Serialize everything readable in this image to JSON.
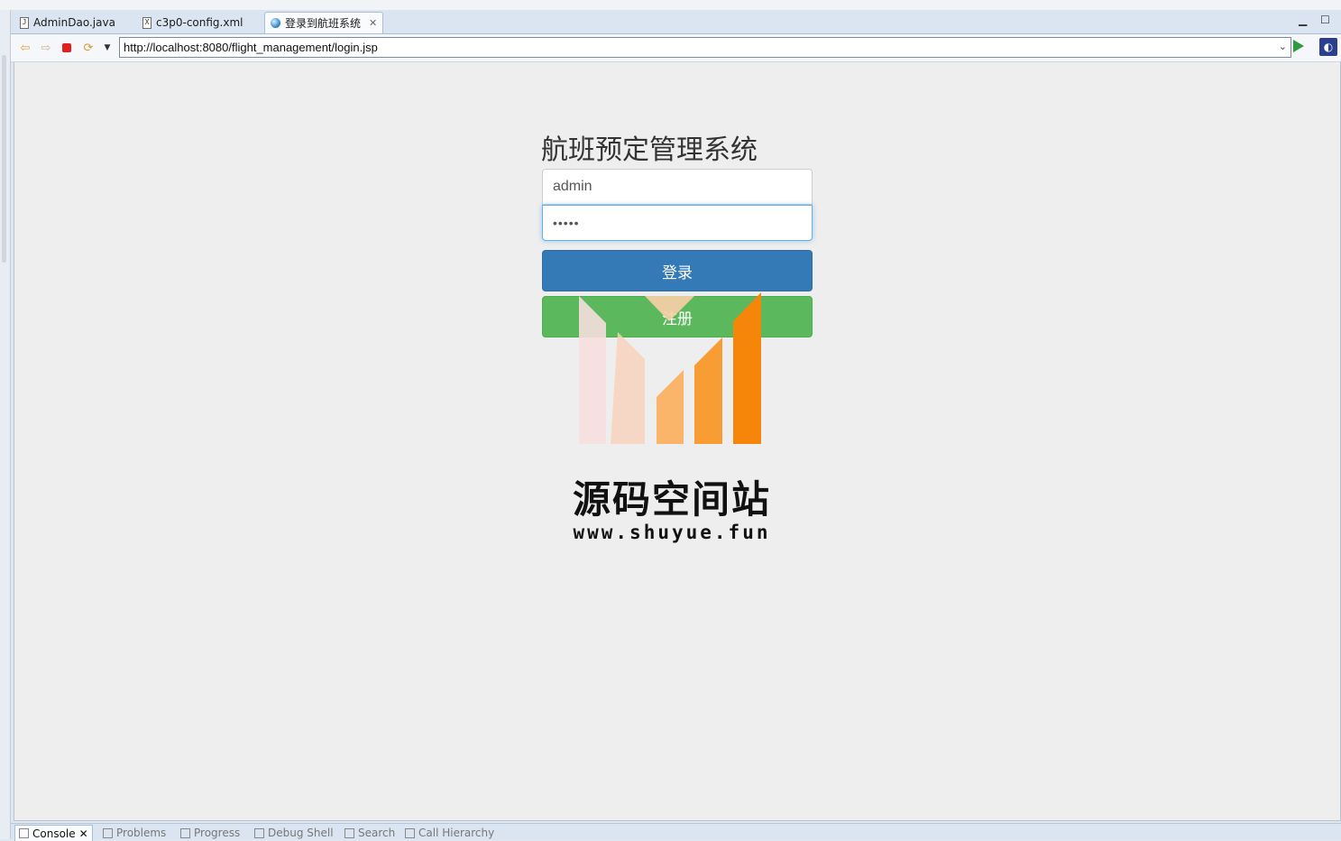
{
  "tabs": [
    {
      "label": "AdminDao.java",
      "icon": "java-file-icon"
    },
    {
      "label": "c3p0-config.xml",
      "icon": "xml-file-icon"
    },
    {
      "label": "登录到航班系统",
      "icon": "globe-icon",
      "active": true
    }
  ],
  "toolbar": {
    "url": "http://localhost:8080/flight_management/login.jsp"
  },
  "page": {
    "title": "航班预定管理系统",
    "username_value": "admin",
    "password_value": "•••••",
    "login_label": "登录",
    "register_label": "注册"
  },
  "watermark": {
    "name": "源码空间站",
    "url": "www.shuyue.fun"
  },
  "bottom_tabs": [
    {
      "label": "Console"
    },
    {
      "label": "Problems"
    },
    {
      "label": "Progress"
    },
    {
      "label": "Debug Shell"
    },
    {
      "label": "Search"
    },
    {
      "label": "Call Hierarchy"
    }
  ],
  "colors": {
    "login_button": "#337ab7",
    "register_button": "#5cb85c",
    "page_background": "#eeeeee"
  }
}
